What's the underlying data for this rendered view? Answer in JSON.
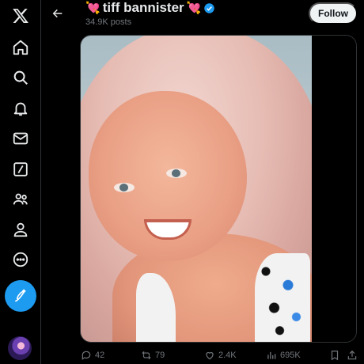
{
  "profile": {
    "display_name": "tiff bannister",
    "name_emoji_left": "💘",
    "name_emoji_right": "💘",
    "verified": true,
    "posts_count": "34.9K posts",
    "follow_label": "Follow"
  },
  "nav": {
    "items": [
      {
        "name": "x-logo-icon"
      },
      {
        "name": "home-icon"
      },
      {
        "name": "search-icon"
      },
      {
        "name": "notifications-icon"
      },
      {
        "name": "messages-icon"
      },
      {
        "name": "grok-icon"
      },
      {
        "name": "communities-icon"
      },
      {
        "name": "profile-icon"
      },
      {
        "name": "more-icon"
      }
    ],
    "compose": "compose-post-icon"
  },
  "post": {
    "replies": "42",
    "reposts": "79",
    "likes": "2.4K",
    "views": "695K"
  },
  "colors": {
    "accent": "#1d9bf0",
    "background": "#000000",
    "text_primary": "#e7e9ea",
    "text_secondary": "#71767b",
    "follow_button": "#eff3f4"
  }
}
